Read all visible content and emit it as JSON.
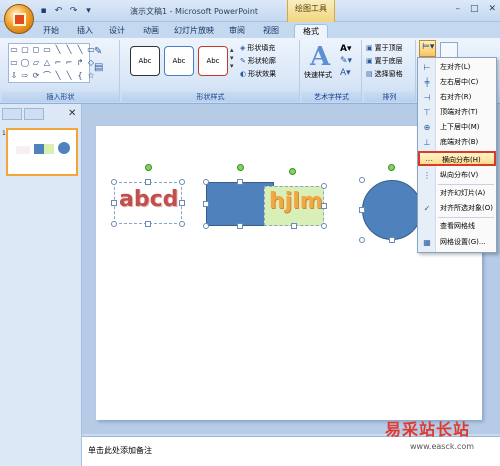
{
  "window": {
    "title": "演示文稿1 - Microsoft PowerPoint",
    "context_tab": "绘图工具"
  },
  "qat": {
    "save_icon": "save-icon",
    "undo_icon": "undo-icon",
    "redo_icon": "redo-icon"
  },
  "tabs": [
    {
      "label": "开始"
    },
    {
      "label": "插入"
    },
    {
      "label": "设计"
    },
    {
      "label": "动画"
    },
    {
      "label": "幻灯片放映"
    },
    {
      "label": "审阅"
    },
    {
      "label": "视图"
    },
    {
      "label": "格式"
    }
  ],
  "ribbon": {
    "insert_shapes": {
      "label": "插入形状",
      "shape_glyphs": [
        "▭",
        "▢",
        "◻",
        "▭",
        "╲",
        "╲",
        "╲",
        "▭",
        "▭",
        "◯",
        "▱",
        "△",
        "⌐",
        "⌐",
        "↱",
        "◇",
        "⇩",
        "⇨",
        "⟳",
        "⌒",
        "╲",
        "╲",
        "{",
        "☆"
      ]
    },
    "shape_styles": {
      "label": "形状样式",
      "preset": "Abc",
      "fill": "形状填充",
      "outline": "形状轮廓",
      "effects": "形状效果"
    },
    "wordart": {
      "label": "艺术字样式",
      "quick_styles": "快速样式"
    },
    "arrange": {
      "label": "排列",
      "bring_front": "置于顶层",
      "send_back": "置于底层",
      "selection_pane": "选择窗格"
    }
  },
  "align_menu": {
    "items": [
      {
        "label": "左对齐(L)",
        "icon": "align-left-icon"
      },
      {
        "label": "左右居中(C)",
        "icon": "align-center-icon"
      },
      {
        "label": "右对齐(R)",
        "icon": "align-right-icon"
      },
      {
        "label": "顶端对齐(T)",
        "icon": "align-top-icon"
      },
      {
        "label": "上下居中(M)",
        "icon": "align-middle-icon"
      },
      {
        "label": "底端对齐(B)",
        "icon": "align-bottom-icon"
      },
      {
        "label": "横向分布(H)",
        "icon": "distribute-horizontal-icon",
        "highlighted": true
      },
      {
        "label": "纵向分布(V)",
        "icon": "distribute-vertical-icon"
      },
      {
        "label": "对齐幻灯片(A)",
        "icon": ""
      },
      {
        "label": "对齐所选对象(O)",
        "icon": "check-icon",
        "checked": true
      },
      {
        "label": "查看网格线",
        "icon": ""
      },
      {
        "label": "网格设置(G)...",
        "icon": "grid-icon"
      }
    ]
  },
  "slide": {
    "text1": "abcd",
    "text2": "hjlm",
    "thumb_number": "1"
  },
  "notes": {
    "placeholder": "单击此处添加备注"
  },
  "watermark": {
    "name": "易采站长站",
    "url": "www.easck.com"
  }
}
